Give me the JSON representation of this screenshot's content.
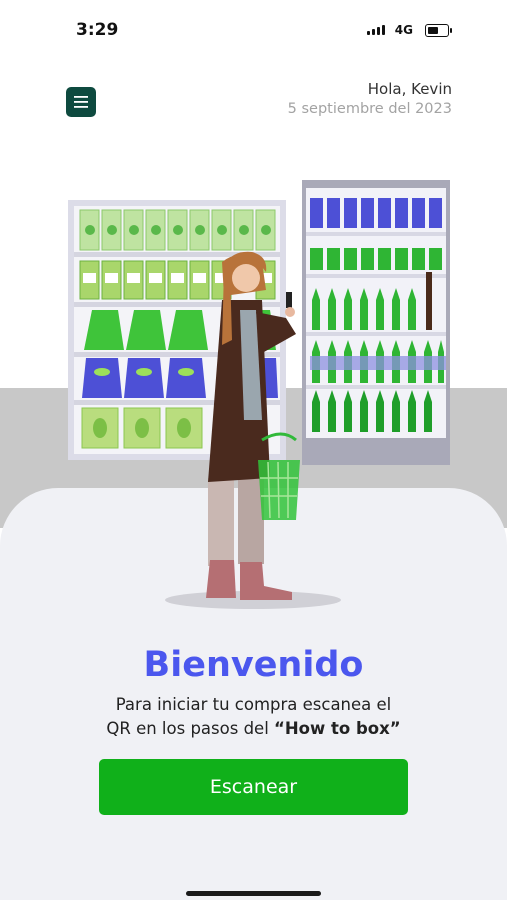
{
  "status_bar": {
    "time": "3:29",
    "network": "4G"
  },
  "header": {
    "greeting": "Hola, Kevin",
    "date": "5 septiembre del 2023"
  },
  "welcome": {
    "title": "Bienvenido",
    "line1": "Para iniciar tu compra escanea el",
    "line2_prefix": "QR en los pasos del ",
    "line2_highlight": "“How to box”"
  },
  "scan_button": {
    "label": "Escanear"
  },
  "colors": {
    "brand_dark": "#0e4a3f",
    "accent_blue": "#4b57ee",
    "primary_green": "#10b01a"
  },
  "icons": [
    "menu-icon",
    "signal-icon",
    "battery-icon"
  ]
}
